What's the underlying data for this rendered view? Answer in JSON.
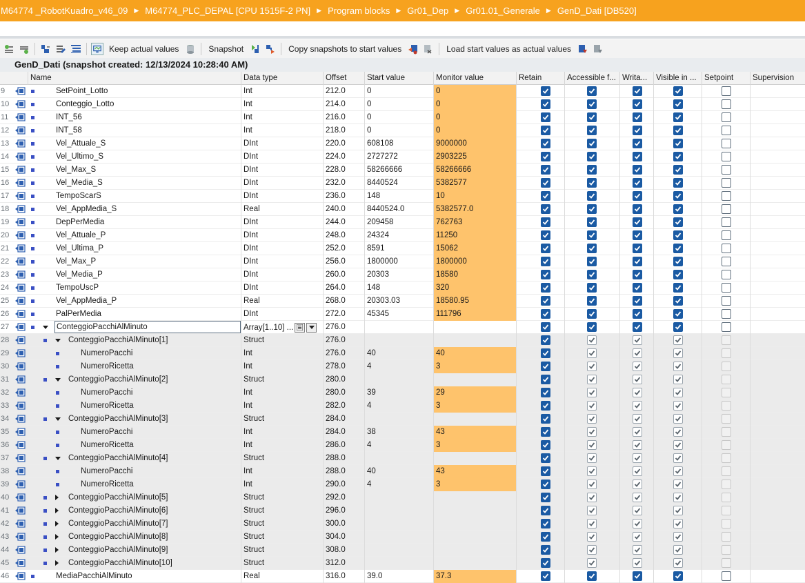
{
  "breadcrumb": [
    "M64774 _RobotKuadro_v46_09",
    "M64774_PLC_DEPAL [CPU 1515F-2 PN]",
    "Program blocks",
    "Gr01_Dep",
    "Gr01.01_Generale",
    "GenD_Dati [DB520]"
  ],
  "toolbar": {
    "keep_actual_values": "Keep actual values",
    "snapshot": "Snapshot",
    "copy_snapshots": "Copy snapshots to start values",
    "load_start_values": "Load start values as actual values"
  },
  "block_title": "GenD_Dati (snapshot created: 12/13/2024 10:28:40 AM)",
  "columns": {
    "name": "Name",
    "data_type": "Data type",
    "offset": "Offset",
    "start_value": "Start value",
    "monitor_value": "Monitor value",
    "retain": "Retain",
    "accessible": "Accessible f...",
    "writable": "Writa...",
    "visible": "Visible in ...",
    "setpoint": "Setpoint",
    "supervision": "Supervision"
  },
  "colors": {
    "breadcrumb_bg": "#f7a21e",
    "monitor_bg": "#fec36c",
    "check_blue": "#1a5aa3"
  },
  "rows": [
    {
      "num": "9",
      "level": 0,
      "expand": "",
      "name": "SetPoint_Lotto",
      "type": "Int",
      "offset": "212.0",
      "start": "0",
      "monitor": "0",
      "grey": false
    },
    {
      "num": "10",
      "level": 0,
      "expand": "",
      "name": "Conteggio_Lotto",
      "type": "Int",
      "offset": "214.0",
      "start": "0",
      "monitor": "0",
      "grey": false
    },
    {
      "num": "11",
      "level": 0,
      "expand": "",
      "name": "INT_56",
      "type": "Int",
      "offset": "216.0",
      "start": "0",
      "monitor": "0",
      "grey": false
    },
    {
      "num": "12",
      "level": 0,
      "expand": "",
      "name": "INT_58",
      "type": "Int",
      "offset": "218.0",
      "start": "0",
      "monitor": "0",
      "grey": false
    },
    {
      "num": "13",
      "level": 0,
      "expand": "",
      "name": "Vel_Attuale_S",
      "type": "DInt",
      "offset": "220.0",
      "start": "608108",
      "monitor": "9000000",
      "grey": false
    },
    {
      "num": "14",
      "level": 0,
      "expand": "",
      "name": "Vel_Ultimo_S",
      "type": "DInt",
      "offset": "224.0",
      "start": "2727272",
      "monitor": "2903225",
      "grey": false
    },
    {
      "num": "15",
      "level": 0,
      "expand": "",
      "name": "Vel_Max_S",
      "type": "DInt",
      "offset": "228.0",
      "start": "58266666",
      "monitor": "58266666",
      "grey": false
    },
    {
      "num": "16",
      "level": 0,
      "expand": "",
      "name": "Vel_Media_S",
      "type": "DInt",
      "offset": "232.0",
      "start": "8440524",
      "monitor": "5382577",
      "grey": false
    },
    {
      "num": "17",
      "level": 0,
      "expand": "",
      "name": "TempoScarS",
      "type": "DInt",
      "offset": "236.0",
      "start": "148",
      "monitor": "10",
      "grey": false
    },
    {
      "num": "18",
      "level": 0,
      "expand": "",
      "name": "Vel_AppMedia_S",
      "type": "Real",
      "offset": "240.0",
      "start": "8440524.0",
      "monitor": "5382577.0",
      "grey": false
    },
    {
      "num": "19",
      "level": 0,
      "expand": "",
      "name": "DepPerMedia",
      "type": "DInt",
      "offset": "244.0",
      "start": "209458",
      "monitor": "762763",
      "grey": false
    },
    {
      "num": "20",
      "level": 0,
      "expand": "",
      "name": "Vel_Attuale_P",
      "type": "DInt",
      "offset": "248.0",
      "start": "24324",
      "monitor": "11250",
      "grey": false
    },
    {
      "num": "21",
      "level": 0,
      "expand": "",
      "name": "Vel_Ultima_P",
      "type": "DInt",
      "offset": "252.0",
      "start": "8591",
      "monitor": "15062",
      "grey": false
    },
    {
      "num": "22",
      "level": 0,
      "expand": "",
      "name": "Vel_Max_P",
      "type": "DInt",
      "offset": "256.0",
      "start": "1800000",
      "monitor": "1800000",
      "grey": false
    },
    {
      "num": "23",
      "level": 0,
      "expand": "",
      "name": "Vel_Media_P",
      "type": "DInt",
      "offset": "260.0",
      "start": "20303",
      "monitor": "18580",
      "grey": false
    },
    {
      "num": "24",
      "level": 0,
      "expand": "",
      "name": "TempoUscP",
      "type": "DInt",
      "offset": "264.0",
      "start": "148",
      "monitor": "320",
      "grey": false
    },
    {
      "num": "25",
      "level": 0,
      "expand": "",
      "name": "Vel_AppMedia_P",
      "type": "Real",
      "offset": "268.0",
      "start": "20303.03",
      "monitor": "18580.95",
      "grey": false
    },
    {
      "num": "26",
      "level": 0,
      "expand": "",
      "name": "PalPerMedia",
      "type": "DInt",
      "offset": "272.0",
      "start": "45345",
      "monitor": "111796",
      "grey": false
    },
    {
      "num": "27",
      "level": 0,
      "expand": "down",
      "name": "ConteggioPacchiAlMinuto",
      "type": "Array[1..10] ...",
      "offset": "276.0",
      "start": "",
      "monitor": "",
      "grey": false,
      "selected": true,
      "array": true
    },
    {
      "num": "28",
      "level": 1,
      "expand": "down",
      "name": "ConteggioPacchiAlMinuto[1]",
      "type": "Struct",
      "offset": "276.0",
      "start": "",
      "monitor": "",
      "grey": true
    },
    {
      "num": "29",
      "level": 2,
      "expand": "",
      "name": "NumeroPacchi",
      "type": "Int",
      "offset": "276.0",
      "start": "40",
      "monitor": "40",
      "grey": true
    },
    {
      "num": "30",
      "level": 2,
      "expand": "",
      "name": "NumeroRicetta",
      "type": "Int",
      "offset": "278.0",
      "start": "4",
      "monitor": "3",
      "grey": true
    },
    {
      "num": "31",
      "level": 1,
      "expand": "down",
      "name": "ConteggioPacchiAlMinuto[2]",
      "type": "Struct",
      "offset": "280.0",
      "start": "",
      "monitor": "",
      "grey": true
    },
    {
      "num": "32",
      "level": 2,
      "expand": "",
      "name": "NumeroPacchi",
      "type": "Int",
      "offset": "280.0",
      "start": "39",
      "monitor": "29",
      "grey": true
    },
    {
      "num": "33",
      "level": 2,
      "expand": "",
      "name": "NumeroRicetta",
      "type": "Int",
      "offset": "282.0",
      "start": "4",
      "monitor": "3",
      "grey": true
    },
    {
      "num": "34",
      "level": 1,
      "expand": "down",
      "name": "ConteggioPacchiAlMinuto[3]",
      "type": "Struct",
      "offset": "284.0",
      "start": "",
      "monitor": "",
      "grey": true
    },
    {
      "num": "35",
      "level": 2,
      "expand": "",
      "name": "NumeroPacchi",
      "type": "Int",
      "offset": "284.0",
      "start": "38",
      "monitor": "43",
      "grey": true
    },
    {
      "num": "36",
      "level": 2,
      "expand": "",
      "name": "NumeroRicetta",
      "type": "Int",
      "offset": "286.0",
      "start": "4",
      "monitor": "3",
      "grey": true
    },
    {
      "num": "37",
      "level": 1,
      "expand": "down",
      "name": "ConteggioPacchiAlMinuto[4]",
      "type": "Struct",
      "offset": "288.0",
      "start": "",
      "monitor": "",
      "grey": true
    },
    {
      "num": "38",
      "level": 2,
      "expand": "",
      "name": "NumeroPacchi",
      "type": "Int",
      "offset": "288.0",
      "start": "40",
      "monitor": "43",
      "grey": true
    },
    {
      "num": "39",
      "level": 2,
      "expand": "",
      "name": "NumeroRicetta",
      "type": "Int",
      "offset": "290.0",
      "start": "4",
      "monitor": "3",
      "grey": true
    },
    {
      "num": "40",
      "level": 1,
      "expand": "right",
      "name": "ConteggioPacchiAlMinuto[5]",
      "type": "Struct",
      "offset": "292.0",
      "start": "",
      "monitor": "",
      "grey": true
    },
    {
      "num": "41",
      "level": 1,
      "expand": "right",
      "name": "ConteggioPacchiAlMinuto[6]",
      "type": "Struct",
      "offset": "296.0",
      "start": "",
      "monitor": "",
      "grey": true
    },
    {
      "num": "42",
      "level": 1,
      "expand": "right",
      "name": "ConteggioPacchiAlMinuto[7]",
      "type": "Struct",
      "offset": "300.0",
      "start": "",
      "monitor": "",
      "grey": true
    },
    {
      "num": "43",
      "level": 1,
      "expand": "right",
      "name": "ConteggioPacchiAlMinuto[8]",
      "type": "Struct",
      "offset": "304.0",
      "start": "",
      "monitor": "",
      "grey": true
    },
    {
      "num": "44",
      "level": 1,
      "expand": "right",
      "name": "ConteggioPacchiAlMinuto[9]",
      "type": "Struct",
      "offset": "308.0",
      "start": "",
      "monitor": "",
      "grey": true
    },
    {
      "num": "45",
      "level": 1,
      "expand": "right",
      "name": "ConteggioPacchiAlMinuto[10]",
      "type": "Struct",
      "offset": "312.0",
      "start": "",
      "monitor": "",
      "grey": true
    },
    {
      "num": "46",
      "level": 0,
      "expand": "",
      "name": "MediaPacchiAlMinuto",
      "type": "Real",
      "offset": "316.0",
      "start": "39.0",
      "monitor": "37.3",
      "grey": false
    }
  ]
}
